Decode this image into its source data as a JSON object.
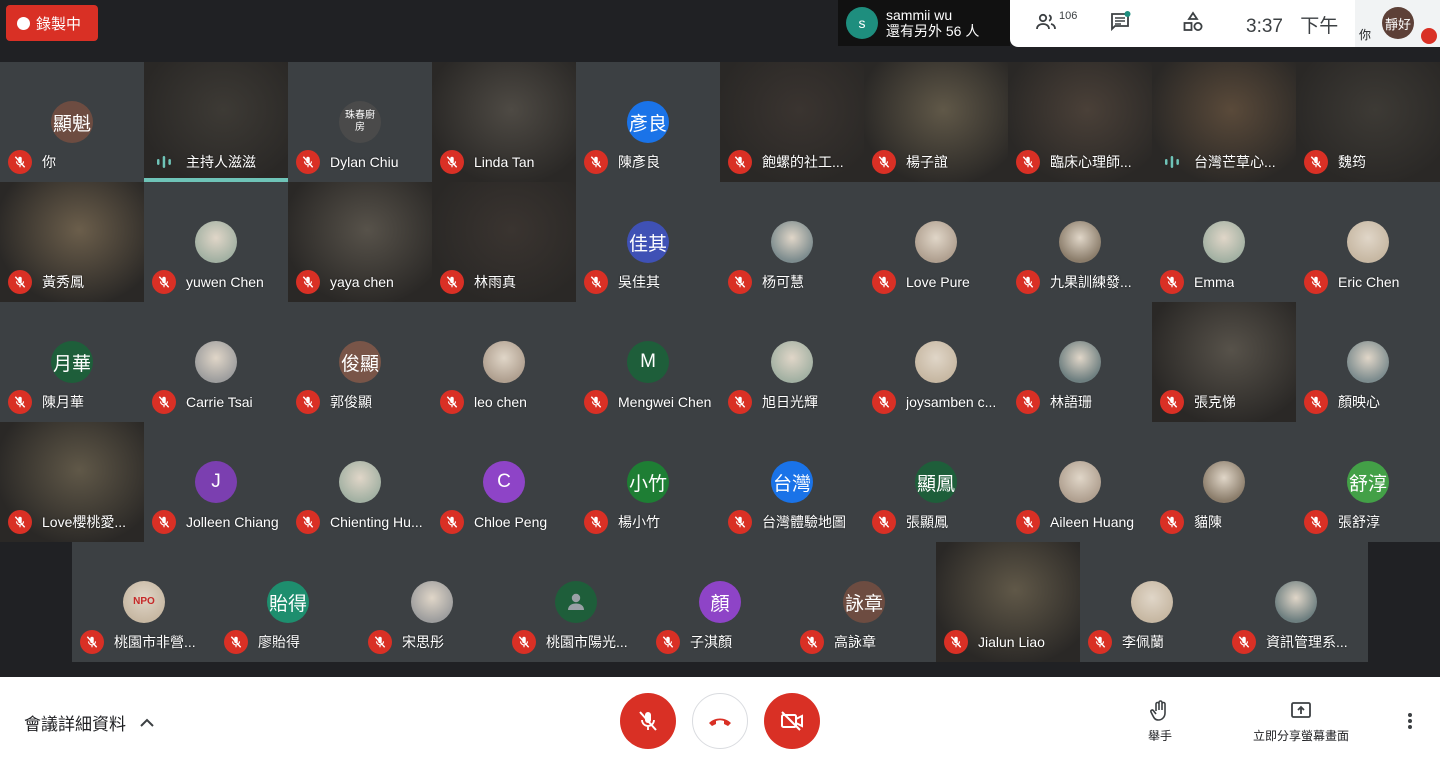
{
  "recording": {
    "label": "錄製中"
  },
  "active_speaker": {
    "initial": "s",
    "name": "sammii wu",
    "subtitle": "還有另外 56 人"
  },
  "topbar": {
    "participants_count": "106",
    "time": "3:37",
    "ampm": "下午",
    "me_label": "你",
    "me_avatar_text": "靜好"
  },
  "tiles": [
    {
      "name": "你",
      "kind": "avatar",
      "avatar": "顯魁",
      "color": "#6d4c41",
      "mic": "off"
    },
    {
      "name": "主持人滋滋",
      "kind": "video",
      "mic": "on",
      "speaking": true
    },
    {
      "name": "Dylan Chiu",
      "kind": "avatar",
      "avatar": "珠春廚房",
      "color": "#4a4a4a",
      "mic": "off"
    },
    {
      "name": "Linda Tan",
      "kind": "video",
      "mic": "off"
    },
    {
      "name": "陳彥良",
      "kind": "avatar",
      "avatar": "彥良",
      "color": "#1a73e8",
      "mic": "off"
    },
    {
      "name": "飽螺的社工...",
      "kind": "video",
      "mic": "off"
    },
    {
      "name": "楊子誼",
      "kind": "video",
      "mic": "off"
    },
    {
      "name": "臨床心理師...",
      "kind": "video",
      "mic": "off"
    },
    {
      "name": "台灣芒草心...",
      "kind": "video",
      "mic": "on"
    },
    {
      "name": "魏筠",
      "kind": "video",
      "mic": "off"
    },
    {
      "name": "黃秀鳳",
      "kind": "video",
      "mic": "off"
    },
    {
      "name": "yuwen Chen",
      "kind": "photo",
      "mic": "off"
    },
    {
      "name": "yaya chen",
      "kind": "video",
      "mic": "off"
    },
    {
      "name": "林雨真",
      "kind": "video",
      "mic": "off"
    },
    {
      "name": "吳佳其",
      "kind": "avatar",
      "avatar": "佳其",
      "color": "#3f51b5",
      "mic": "off"
    },
    {
      "name": "杨可慧",
      "kind": "photo",
      "mic": "off"
    },
    {
      "name": "Love Pure",
      "kind": "photo",
      "mic": "off"
    },
    {
      "name": "九果訓練發...",
      "kind": "photo",
      "mic": "off"
    },
    {
      "name": "Emma",
      "kind": "photo",
      "mic": "off"
    },
    {
      "name": "Eric Chen",
      "kind": "photo",
      "mic": "off"
    },
    {
      "name": "陳月華",
      "kind": "avatar",
      "avatar": "月華",
      "color": "#1e5e3a",
      "mic": "off"
    },
    {
      "name": "Carrie Tsai",
      "kind": "photo",
      "mic": "off"
    },
    {
      "name": "郭俊顯",
      "kind": "avatar",
      "avatar": "俊顯",
      "color": "#795548",
      "mic": "off"
    },
    {
      "name": "leo chen",
      "kind": "photo",
      "mic": "off"
    },
    {
      "name": "Mengwei Chen",
      "kind": "avatar",
      "avatar": "M",
      "color": "#1e5e3a",
      "mic": "off"
    },
    {
      "name": "旭日光輝",
      "kind": "photo",
      "mic": "off"
    },
    {
      "name": "joysamben c...",
      "kind": "photo",
      "mic": "off"
    },
    {
      "name": "林語珊",
      "kind": "photo",
      "mic": "off"
    },
    {
      "name": "張克悌",
      "kind": "video",
      "mic": "off"
    },
    {
      "name": "顏映心",
      "kind": "photo",
      "mic": "off"
    },
    {
      "name": "Love櫻桃愛...",
      "kind": "video",
      "mic": "off"
    },
    {
      "name": "Jolleen Chiang",
      "kind": "avatar",
      "avatar": "J",
      "color": "#7b3fb0",
      "mic": "off"
    },
    {
      "name": "Chienting Hu...",
      "kind": "photo",
      "mic": "off"
    },
    {
      "name": "Chloe Peng",
      "kind": "avatar",
      "avatar": "C",
      "color": "#8e44c7",
      "mic": "off"
    },
    {
      "name": "楊小竹",
      "kind": "avatar",
      "avatar": "小竹",
      "color": "#1e7e34",
      "mic": "off"
    },
    {
      "name": "台灣體驗地圖",
      "kind": "avatar",
      "avatar": "台灣",
      "color": "#1a73e8",
      "mic": "off"
    },
    {
      "name": "張顯鳳",
      "kind": "avatar",
      "avatar": "顯鳳",
      "color": "#1e5e3a",
      "mic": "off"
    },
    {
      "name": "Aileen Huang",
      "kind": "photo",
      "mic": "off"
    },
    {
      "name": "貓陳",
      "kind": "photo",
      "mic": "off"
    },
    {
      "name": "張舒淳",
      "kind": "avatar",
      "avatar": "舒淳",
      "color": "#43a047",
      "mic": "off"
    },
    {
      "name": "桃園市非營...",
      "kind": "photo",
      "avatar": "NPO",
      "mic": "off"
    },
    {
      "name": "廖貽得",
      "kind": "avatar",
      "avatar": "貽得",
      "color": "#1e8e6e",
      "mic": "off"
    },
    {
      "name": "宋思彤",
      "kind": "photo",
      "mic": "off"
    },
    {
      "name": "桃園市陽光...",
      "kind": "avatar",
      "avatar": "",
      "color": "#1e5e3a",
      "mic": "off"
    },
    {
      "name": "子淇顏",
      "kind": "avatar",
      "avatar": "顏",
      "color": "#8e44c7",
      "mic": "off"
    },
    {
      "name": "高詠章",
      "kind": "avatar",
      "avatar": "詠章",
      "color": "#6d4c41",
      "mic": "off"
    },
    {
      "name": "Jialun Liao",
      "kind": "video",
      "mic": "off"
    },
    {
      "name": "李佩蘭",
      "kind": "photo",
      "mic": "off"
    },
    {
      "name": "資訊管理系...",
      "kind": "photo",
      "mic": "off"
    }
  ],
  "bottom": {
    "details_label": "會議詳細資料",
    "raise_hand_label": "舉手",
    "present_label": "立即分享螢幕畫面"
  }
}
